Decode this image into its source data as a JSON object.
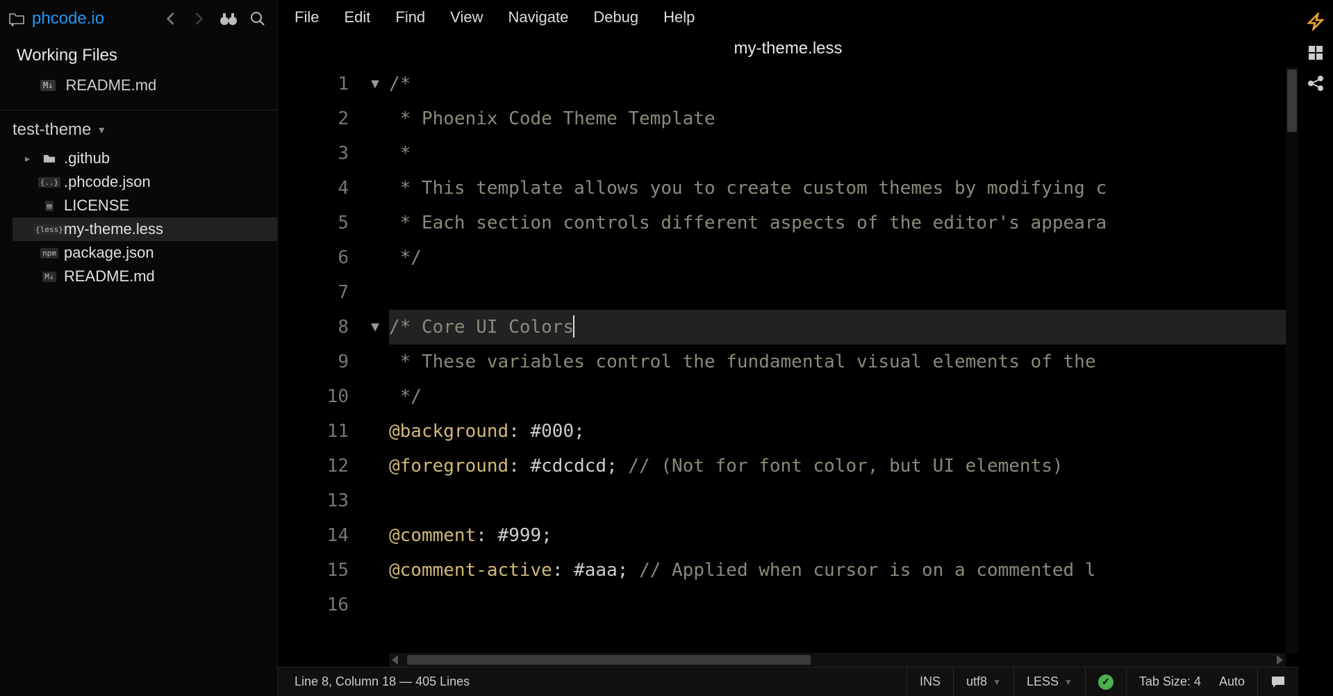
{
  "brand": "phcode.io",
  "working_files": {
    "header": "Working Files",
    "items": [
      {
        "name": "README.md",
        "type": "M↓"
      }
    ]
  },
  "project": {
    "name": "test-theme",
    "tree": [
      {
        "name": ".github",
        "kind": "folder",
        "indent": 0
      },
      {
        "name": ".phcode.json",
        "kind": "file",
        "badge": "{..}",
        "indent": 0
      },
      {
        "name": "LICENSE",
        "kind": "file",
        "badge": "▤",
        "indent": 0
      },
      {
        "name": "my-theme.less",
        "kind": "file",
        "badge": "{less}",
        "indent": 0,
        "selected": true
      },
      {
        "name": "package.json",
        "kind": "file",
        "badge": "npm",
        "indent": 0
      },
      {
        "name": "README.md",
        "kind": "file",
        "badge": "M↓",
        "indent": 0
      }
    ]
  },
  "menu": [
    "File",
    "Edit",
    "Find",
    "View",
    "Navigate",
    "Debug",
    "Help"
  ],
  "tab": "my-theme.less",
  "editor": {
    "lines": [
      {
        "n": 1,
        "fold": "▼",
        "seg": [
          [
            "cm-comment",
            "/*"
          ]
        ]
      },
      {
        "n": 2,
        "fold": "",
        "seg": [
          [
            "cm-comment",
            " * Phoenix Code Theme Template"
          ]
        ]
      },
      {
        "n": 3,
        "fold": "",
        "seg": [
          [
            "cm-comment",
            " *"
          ]
        ]
      },
      {
        "n": 4,
        "fold": "",
        "seg": [
          [
            "cm-comment",
            " * This template allows you to create custom themes by modifying c"
          ]
        ]
      },
      {
        "n": 5,
        "fold": "",
        "seg": [
          [
            "cm-comment",
            " * Each section controls different aspects of the editor's appeara"
          ]
        ]
      },
      {
        "n": 6,
        "fold": "",
        "seg": [
          [
            "cm-comment",
            " */"
          ]
        ]
      },
      {
        "n": 7,
        "fold": "",
        "seg": [
          [
            "",
            ""
          ]
        ]
      },
      {
        "n": 8,
        "fold": "▼",
        "seg": [
          [
            "cm-comment",
            "/* Core UI Colors"
          ]
        ],
        "current": true,
        "cursor": true
      },
      {
        "n": 9,
        "fold": "",
        "seg": [
          [
            "cm-comment",
            " * These variables control the fundamental visual elements of the "
          ]
        ]
      },
      {
        "n": 10,
        "fold": "",
        "seg": [
          [
            "cm-comment",
            " */"
          ]
        ]
      },
      {
        "n": 11,
        "fold": "",
        "seg": [
          [
            "cm-var",
            "@background"
          ],
          [
            "cm-punct",
            ": "
          ],
          [
            "cm-val",
            "#000"
          ],
          [
            "cm-punct",
            ";"
          ]
        ]
      },
      {
        "n": 12,
        "fold": "",
        "seg": [
          [
            "cm-var",
            "@foreground"
          ],
          [
            "cm-punct",
            ": "
          ],
          [
            "cm-val",
            "#cdcdcd"
          ],
          [
            "cm-punct",
            "; "
          ],
          [
            "cm-comment",
            "// (Not for font color, but UI elements)"
          ]
        ]
      },
      {
        "n": 13,
        "fold": "",
        "seg": [
          [
            "",
            ""
          ]
        ]
      },
      {
        "n": 14,
        "fold": "",
        "seg": [
          [
            "cm-var",
            "@comment"
          ],
          [
            "cm-punct",
            ": "
          ],
          [
            "cm-val",
            "#999"
          ],
          [
            "cm-punct",
            ";"
          ]
        ]
      },
      {
        "n": 15,
        "fold": "",
        "seg": [
          [
            "cm-var",
            "@comment-active"
          ],
          [
            "cm-punct",
            ": "
          ],
          [
            "cm-val",
            "#aaa"
          ],
          [
            "cm-punct",
            "; "
          ],
          [
            "cm-comment",
            "// Applied when cursor is on a commented l"
          ]
        ]
      },
      {
        "n": 16,
        "fold": "",
        "seg": [
          [
            "",
            ""
          ]
        ]
      }
    ]
  },
  "status": {
    "position": "Line 8, Column 18 — 405 Lines",
    "ins": "INS",
    "encoding": "utf8",
    "lang": "LESS",
    "tabsize": "Tab Size: 4",
    "auto": "Auto"
  }
}
